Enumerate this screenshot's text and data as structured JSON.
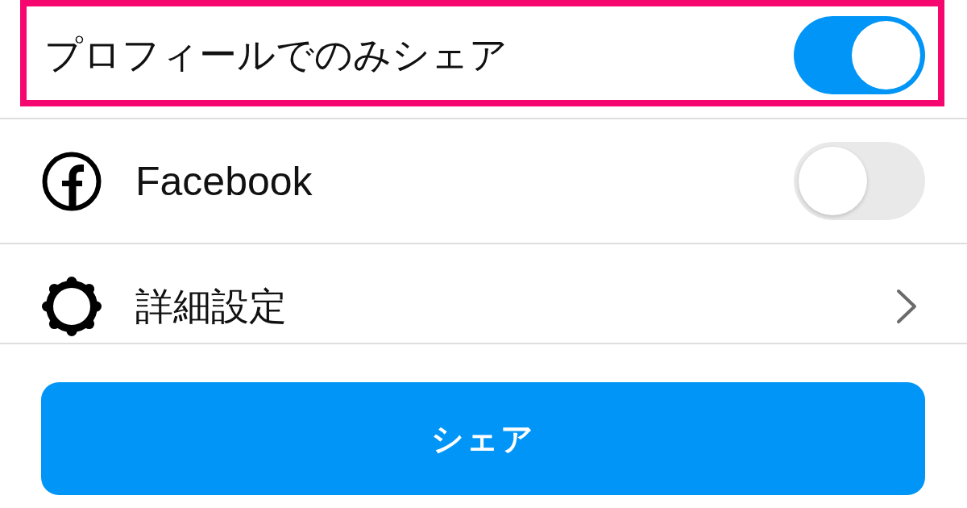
{
  "profile_only": {
    "label": "プロフィールでのみシェア",
    "on": true,
    "highlighted": true
  },
  "facebook": {
    "label": "Facebook",
    "on": false
  },
  "advanced_settings": {
    "label": "詳細設定"
  },
  "share_button": {
    "label": "シェア"
  }
}
